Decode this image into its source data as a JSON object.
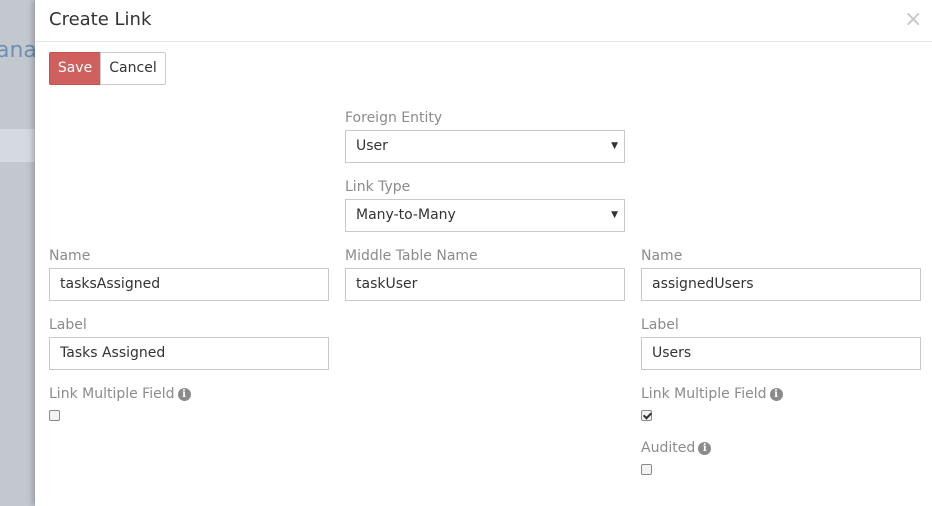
{
  "background": {
    "heading_fragment": "anag"
  },
  "modal": {
    "title": "Create Link",
    "close_glyph": "×",
    "buttons": {
      "save": "Save",
      "cancel": "Cancel"
    },
    "center": {
      "foreign_entity_label": "Foreign Entity",
      "foreign_entity_value": "User",
      "link_type_label": "Link Type",
      "link_type_value": "Many-to-Many",
      "middle_table_label": "Middle Table Name",
      "middle_table_value": "taskUser"
    },
    "left": {
      "name_label": "Name",
      "name_value": "tasksAssigned",
      "label_label": "Label",
      "label_value": "Tasks Assigned",
      "link_multiple_label": "Link Multiple Field",
      "link_multiple_checked": false
    },
    "right": {
      "name_label": "Name",
      "name_value": "assignedUsers",
      "label_label": "Label",
      "label_value": "Users",
      "link_multiple_label": "Link Multiple Field",
      "link_multiple_checked": true,
      "audited_label": "Audited",
      "audited_checked": false
    }
  },
  "colors": {
    "save_button": "#cf605d",
    "backdrop": "#c3c8cf"
  },
  "icons": {
    "info": "i",
    "caret": "▼"
  }
}
